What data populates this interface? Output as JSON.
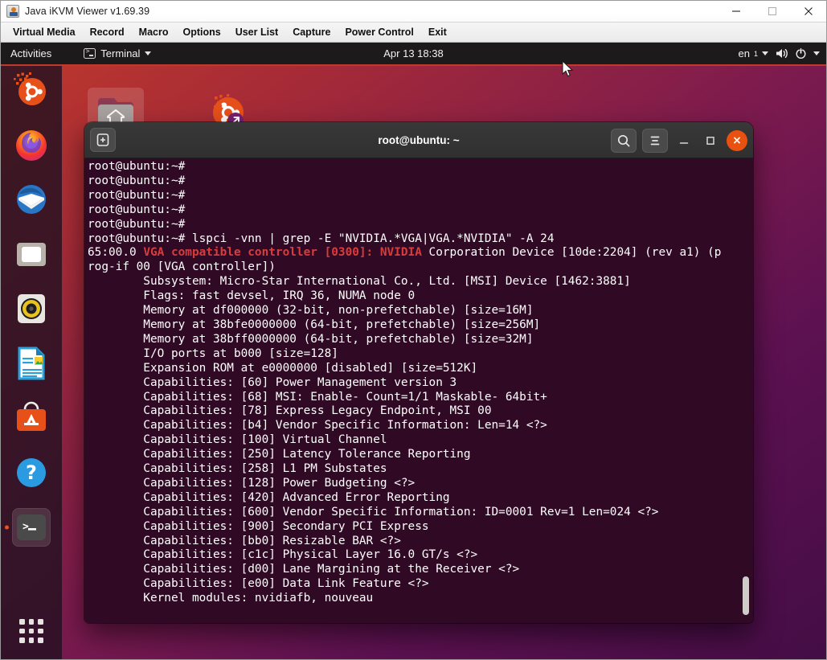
{
  "kvm": {
    "title": "Java iKVM Viewer v1.69.39",
    "app_icon": "java-icon",
    "menu": [
      {
        "label": "Virtual Media",
        "name": "menu-virtual-media"
      },
      {
        "label": "Record",
        "name": "menu-record"
      },
      {
        "label": "Macro",
        "name": "menu-macro"
      },
      {
        "label": "Options",
        "name": "menu-options"
      },
      {
        "label": "User List",
        "name": "menu-user-list"
      },
      {
        "label": "Capture",
        "name": "menu-capture"
      },
      {
        "label": "Power Control",
        "name": "menu-power-control"
      },
      {
        "label": "Exit",
        "name": "menu-exit"
      }
    ],
    "window_controls": {
      "minimize": "minimize-icon",
      "maximize": "maximize-icon",
      "close": "close-icon"
    }
  },
  "gnome_topbar": {
    "activities": "Activities",
    "app_menu": "Terminal",
    "clock": "Apr 13  18:38",
    "language": "en",
    "language_sub": "1",
    "volume_icon": "volume-icon",
    "power_icon": "power-icon",
    "accent_color": "#c0392b"
  },
  "dock": {
    "items": [
      {
        "name": "dock-item-ubuntu-software-store",
        "label": "Ubuntu",
        "icon": "ubuntu-logo-icon",
        "active": false
      },
      {
        "name": "dock-item-firefox",
        "label": "Firefox",
        "icon": "firefox-icon",
        "active": false
      },
      {
        "name": "dock-item-thunderbird",
        "label": "Thunderbird",
        "icon": "thunderbird-icon",
        "active": false
      },
      {
        "name": "dock-item-files",
        "label": "Files",
        "icon": "files-folder-icon",
        "active": false
      },
      {
        "name": "dock-item-rhythmbox",
        "label": "Rhythmbox",
        "icon": "speaker-icon",
        "active": false
      },
      {
        "name": "dock-item-libreoffice-writer",
        "label": "LibreOffice Writer",
        "icon": "document-icon",
        "active": false
      },
      {
        "name": "dock-item-ubuntu-software",
        "label": "Ubuntu Software",
        "icon": "software-bag-icon",
        "active": false
      },
      {
        "name": "dock-item-help",
        "label": "Help",
        "icon": "question-mark-icon",
        "active": false
      },
      {
        "name": "dock-item-terminal",
        "label": "Terminal",
        "icon": "terminal-icon",
        "active": true
      }
    ],
    "show_apps": "show-applications-icon"
  },
  "desktop_icons": [
    {
      "name": "desktop-icon-home",
      "label": "",
      "icon": "home-folder-icon"
    },
    {
      "name": "desktop-icon-install-ubuntu",
      "label": "",
      "icon": "install-ubuntu-icon"
    }
  ],
  "terminal": {
    "title": "root@ubuntu: ~",
    "new_tab_icon": "new-tab-icon",
    "search_icon": "search-icon",
    "menu_icon": "hamburger-menu-icon",
    "minimize_icon": "minimize-icon",
    "maximize_icon": "maximize-icon",
    "close_icon": "close-icon",
    "close_label": "×",
    "background_color": "#300a24",
    "grep_match_color": "#d83c3c",
    "lines": [
      {
        "text": "root@ubuntu:~#"
      },
      {
        "text": "root@ubuntu:~#"
      },
      {
        "text": "root@ubuntu:~#"
      },
      {
        "text": "root@ubuntu:~#"
      },
      {
        "text": "root@ubuntu:~#"
      },
      {
        "text": "root@ubuntu:~# lspci -vnn | grep -E \"NVIDIA.*VGA|VGA.*NVIDIA\" -A 24"
      },
      {
        "parts": [
          {
            "t": "65:00.0 ",
            "c": "normal"
          },
          {
            "t": "VGA compatible controller [0300]: NVIDIA",
            "c": "grep"
          },
          {
            "t": " Corporation Device [10de:2204] (rev a1) (p",
            "c": "normal"
          }
        ]
      },
      {
        "text": "rog-if 00 [VGA controller])"
      },
      {
        "text": "        Subsystem: Micro-Star International Co., Ltd. [MSI] Device [1462:3881]"
      },
      {
        "text": "        Flags: fast devsel, IRQ 36, NUMA node 0"
      },
      {
        "text": "        Memory at df000000 (32-bit, non-prefetchable) [size=16M]"
      },
      {
        "text": "        Memory at 38bfe0000000 (64-bit, prefetchable) [size=256M]"
      },
      {
        "text": "        Memory at 38bff0000000 (64-bit, prefetchable) [size=32M]"
      },
      {
        "text": "        I/O ports at b000 [size=128]"
      },
      {
        "text": "        Expansion ROM at e0000000 [disabled] [size=512K]"
      },
      {
        "text": "        Capabilities: [60] Power Management version 3"
      },
      {
        "text": "        Capabilities: [68] MSI: Enable- Count=1/1 Maskable- 64bit+"
      },
      {
        "text": "        Capabilities: [78] Express Legacy Endpoint, MSI 00"
      },
      {
        "text": "        Capabilities: [b4] Vendor Specific Information: Len=14 <?>"
      },
      {
        "text": "        Capabilities: [100] Virtual Channel"
      },
      {
        "text": "        Capabilities: [250] Latency Tolerance Reporting"
      },
      {
        "text": "        Capabilities: [258] L1 PM Substates"
      },
      {
        "text": "        Capabilities: [128] Power Budgeting <?>"
      },
      {
        "text": "        Capabilities: [420] Advanced Error Reporting"
      },
      {
        "text": "        Capabilities: [600] Vendor Specific Information: ID=0001 Rev=1 Len=024 <?>"
      },
      {
        "text": "        Capabilities: [900] Secondary PCI Express"
      },
      {
        "text": "        Capabilities: [bb0] Resizable BAR <?>"
      },
      {
        "text": "        Capabilities: [c1c] Physical Layer 16.0 GT/s <?>"
      },
      {
        "text": "        Capabilities: [d00] Lane Margining at the Receiver <?>"
      },
      {
        "text": "        Capabilities: [e00] Data Link Feature <?>"
      },
      {
        "text": "        Kernel modules: nvidiafb, nouveau"
      }
    ]
  }
}
